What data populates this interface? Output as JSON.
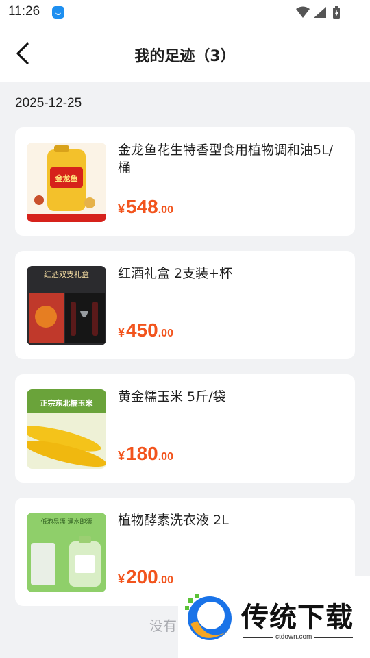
{
  "status_bar": {
    "time": "11:26"
  },
  "header": {
    "title": "我的足迹（3）"
  },
  "date_group": "2025-12-25",
  "products": [
    {
      "name": "金龙鱼花生特香型食用植物调和油5L/桶",
      "currency": "¥",
      "price_int": "548",
      "price_dec": ".00",
      "thumb_label": "金龙鱼"
    },
    {
      "name": "红酒礼盒  2支装+杯",
      "currency": "¥",
      "price_int": "450",
      "price_dec": ".00",
      "thumb_label": "红酒双支礼盒"
    },
    {
      "name": "黄金糯玉米 5斤/袋",
      "currency": "¥",
      "price_int": "180",
      "price_dec": ".00",
      "thumb_label": "正宗东北糯玉米"
    },
    {
      "name": "植物酵素洗衣液 2L",
      "currency": "¥",
      "price_int": "200",
      "price_dec": ".00",
      "thumb_label": "低泡易漂 涌水即漂"
    }
  ],
  "footer_tip": "没有",
  "watermark": {
    "text": "传统下载",
    "url": "ctdown.com"
  },
  "colors": {
    "price": "#f2541d",
    "background": "#f1f2f4",
    "card": "#ffffff"
  }
}
